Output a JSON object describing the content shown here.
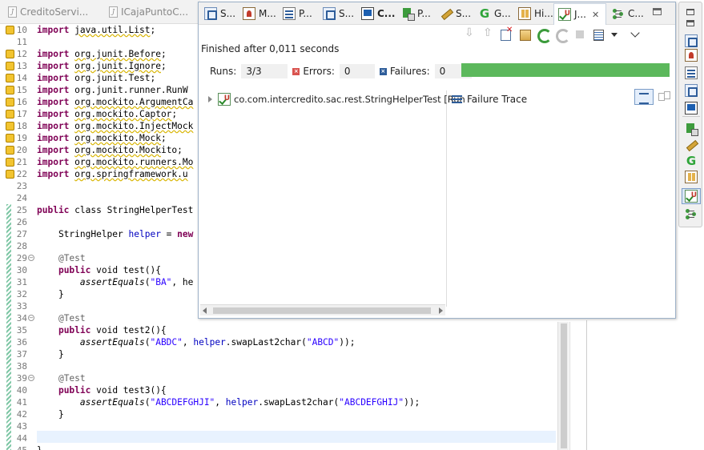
{
  "editor_tabs": [
    {
      "label": "CreditoServi..."
    },
    {
      "label": "ICajaPuntoC..."
    }
  ],
  "editor": {
    "line_numbers": [
      "10",
      "11",
      "12",
      "13",
      "14",
      "15",
      "16",
      "17",
      "18",
      "19",
      "20",
      "21",
      "22",
      "23",
      "24",
      "25",
      "26",
      "27",
      "28",
      "29",
      "30",
      "31",
      "32",
      "33",
      "34",
      "35",
      "36",
      "37",
      "38",
      "39",
      "40",
      "41",
      "42",
      "43",
      "44",
      "45"
    ],
    "code_lines": [
      "import java.util.List;",
      "",
      "import org.junit.Before;",
      "import org.junit.Ignore;",
      "import org.junit.Test;",
      "import org.junit.runner.RunW",
      "import org.mockito.ArgumentCa",
      "import org.mockito.Captor;",
      "import org.mockito.InjectMock",
      "import org.mockito.Mock;",
      "import org.mockito.Mockito;",
      "import org.mockito.runners.Mo",
      "import org.springframework.u",
      "",
      "",
      "public class StringHelperTest",
      "",
      "    StringHelper helper = new",
      "",
      "    @Test",
      "    public void test(){",
      "        assertEquals(\"BA\", he",
      "    }",
      "",
      "    @Test",
      "    public void test2(){",
      "        assertEquals(\"ABDC\", helper.swapLast2char(\"ABCD\"));",
      "    }",
      "",
      "    @Test",
      "    public void test3(){",
      "        assertEquals(\"ABCDEFGHJI\", helper.swapLast2char(\"ABCDEFGHIJ\"));",
      "    }",
      "",
      "",
      "}"
    ]
  },
  "junit_view": {
    "tabs": [
      {
        "label": "S...",
        "icon": "servers-icon"
      },
      {
        "label": "M...",
        "icon": "markers-icon"
      },
      {
        "label": "P...",
        "icon": "properties-icon"
      },
      {
        "label": "S...",
        "icon": "snippets-icon"
      },
      {
        "label": "C...",
        "icon": "console-icon"
      },
      {
        "label": "P...",
        "icon": "progress-icon"
      },
      {
        "label": "S...",
        "icon": "search-icon"
      },
      {
        "label": "G...",
        "icon": "gradle-icon"
      },
      {
        "label": "Hi...",
        "icon": "history-icon"
      },
      {
        "label": "J...",
        "icon": "junit-icon"
      },
      {
        "label": "C...",
        "icon": "coverage-icon"
      }
    ],
    "active_tab": "J...",
    "close_glyph": "✕",
    "status": "Finished after 0,011 seconds",
    "runs_label": "Runs:",
    "runs_value": "3/3",
    "errors_label": "Errors:",
    "errors_value": "0",
    "failures_label": "Failures:",
    "failures_value": "0",
    "progress_fraction": 1.0,
    "progress_color": "#5cb85c",
    "tree_item": "co.com.intercredito.sac.rest.StringHelperTest [Run",
    "failure_trace_label": "Failure Trace"
  }
}
